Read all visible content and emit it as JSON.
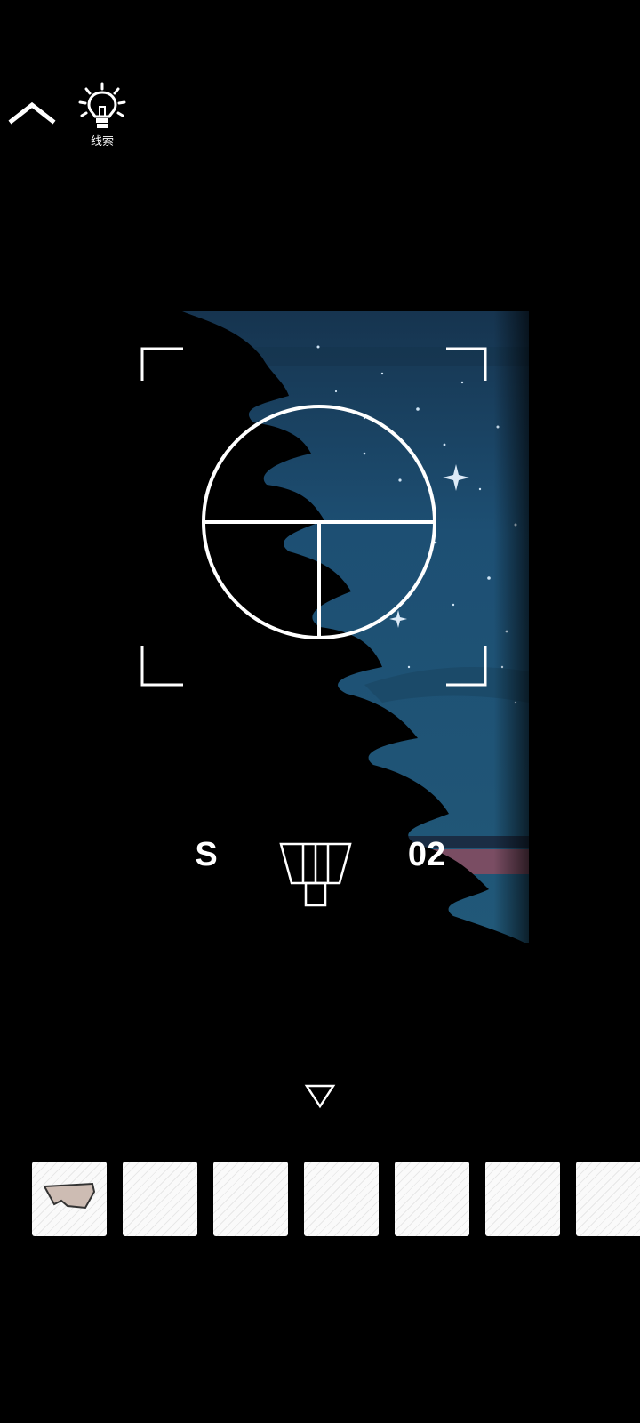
{
  "toolbar": {
    "back_icon": "chevron-up-icon",
    "hint_icon": "lightbulb-icon",
    "hint_label": "线索"
  },
  "scene": {
    "sky_color": "#1d4f73",
    "silhouette_color": "#000000",
    "ground_stripe_color": "#7a4d63",
    "reticle_color": "#ffffff"
  },
  "compass": {
    "direction": "S",
    "frame_number": "02",
    "window_icon": "window-shape-icon"
  },
  "navigation": {
    "down_icon": "triangle-down-icon"
  },
  "inventory": {
    "slots": [
      {
        "item": "paper-scrap-icon",
        "filled": true
      },
      {
        "item": "",
        "filled": false
      },
      {
        "item": "",
        "filled": false
      },
      {
        "item": "",
        "filled": false
      },
      {
        "item": "",
        "filled": false
      },
      {
        "item": "",
        "filled": false
      },
      {
        "item": "",
        "filled": false
      }
    ]
  }
}
